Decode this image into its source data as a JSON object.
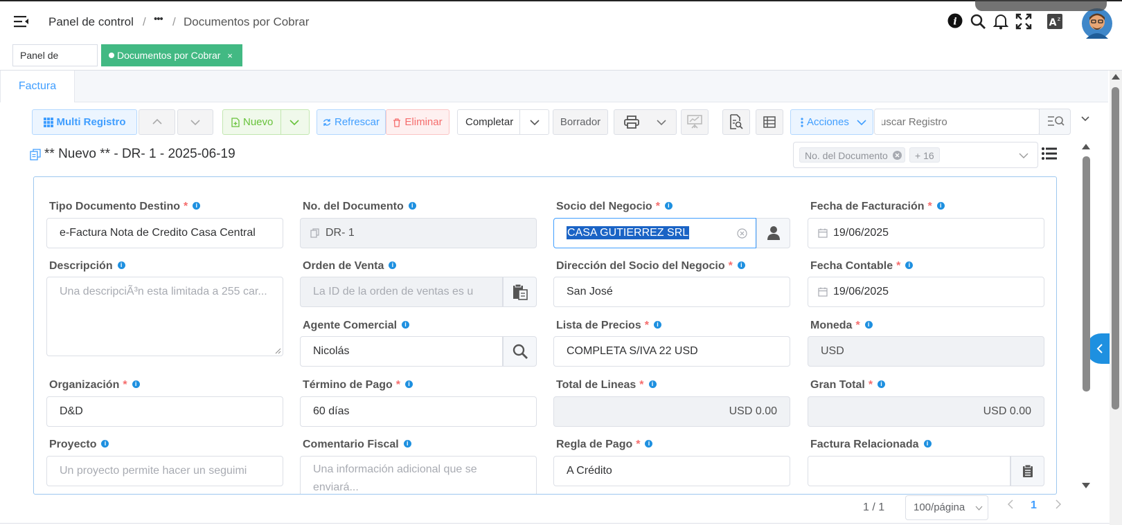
{
  "header": {
    "breadcrumb": [
      "Panel de control",
      "Documentos por Cobrar"
    ],
    "ellipsis": "•••",
    "sep": "/"
  },
  "tags": [
    {
      "label": "Panel de control"
    },
    {
      "label": "Documentos por Cobrar",
      "close": "×"
    }
  ],
  "tab": {
    "label": "Factura"
  },
  "toolbar": {
    "multi_registro": "Multi Registro",
    "nuevo": "Nuevo",
    "refrescar": "Refrescar",
    "eliminar": "Eliminar",
    "completar": "Completar",
    "borrador": "Borrador",
    "acciones": "Acciones",
    "search_placeholder": "Buscar Registro"
  },
  "record": {
    "title": "** Nuevo ** - DR- 1 - 2025-06-19",
    "column_chip": "No. del Documento",
    "column_more": "+ 16"
  },
  "fields": {
    "tipo_doc": {
      "label": "Tipo Documento Destino",
      "value": "e-Factura Nota de Credito Casa Central"
    },
    "no_doc": {
      "label": "No. del Documento",
      "value": "DR- 1"
    },
    "socio": {
      "label": "Socio del Negocio",
      "value": "CASA GUTIERREZ SRL"
    },
    "fecha_fact": {
      "label": "Fecha de Facturación",
      "value": "19/06/2025"
    },
    "descripcion": {
      "label": "Descripción",
      "placeholder": "Una descripciÃ³n esta limitada a 255 car..."
    },
    "orden_venta": {
      "label": "Orden de Venta",
      "placeholder": "La ID de la orden de ventas es u"
    },
    "direccion": {
      "label": "Dirección del Socio del Negocio",
      "value": "San José"
    },
    "fecha_contable": {
      "label": "Fecha Contable",
      "value": "19/06/2025"
    },
    "agente": {
      "label": "Agente Comercial",
      "value": "Nicolás"
    },
    "lista_precios": {
      "label": "Lista de Precios",
      "value": "COMPLETA S/IVA 22 USD"
    },
    "moneda": {
      "label": "Moneda",
      "value": "USD"
    },
    "organizacion": {
      "label": "Organización",
      "value": "D&D"
    },
    "termino_pago": {
      "label": "Término de Pago",
      "value": "60 días"
    },
    "total_lineas": {
      "label": "Total de Lineas",
      "value": "USD 0.00"
    },
    "gran_total": {
      "label": "Gran Total",
      "value": "USD 0.00"
    },
    "proyecto": {
      "label": "Proyecto",
      "placeholder": "Un proyecto permite hacer un seguimi"
    },
    "comentario": {
      "label": "Comentario Fiscal",
      "placeholder": "Una información adicional que se enviará..."
    },
    "regla_pago": {
      "label": "Regla de Pago",
      "value": "A Crédito"
    },
    "factura_rel": {
      "label": "Factura Relacionada",
      "value": ""
    }
  },
  "required_mark": "*",
  "info_glyph": "i",
  "pager": {
    "total": "1 / 1",
    "page_size": "100/página",
    "current": "1"
  },
  "colors": {
    "accent": "#409eff",
    "tag_active": "#42b983",
    "required": "#f56c6c",
    "info": "#1e90e0"
  }
}
